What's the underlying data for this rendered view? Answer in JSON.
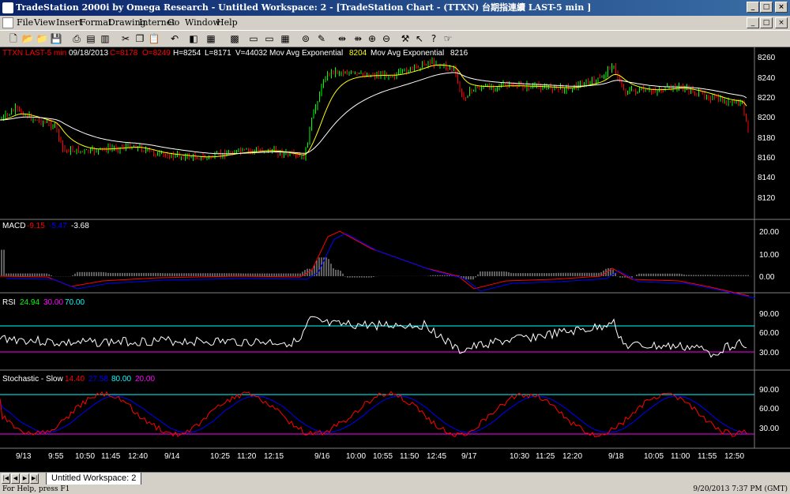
{
  "window": {
    "title": "TradeStation 2000i by Omega Research - Untitled Workspace: 2 - [TradeStation Chart - (TTXN) 台期指連續 LAST-5 min ]",
    "controls": [
      "_",
      "□",
      "×"
    ]
  },
  "menu": {
    "items": [
      "File",
      "View",
      "Insert",
      "Format",
      "Drawing",
      "Internet",
      "Go",
      "Window",
      "Help"
    ],
    "mdi_controls": [
      "_",
      "□",
      "×"
    ]
  },
  "toolbar": {
    "buttons": [
      "new-icon",
      "open-icon",
      "open-folder-icon",
      "save-icon",
      "print-icon",
      "print-preview-icon",
      "page-setup-icon",
      "cut-icon",
      "copy-icon",
      "paste-icon",
      "undo-icon",
      "format-icon",
      "bar-chart-icon",
      "grid-icon",
      "window-icon",
      "window2-icon",
      "tile-icon",
      "radar-icon",
      "zoom-in-icon",
      "zoom-out-icon",
      "tools-icon",
      "pointer-icon",
      "help-icon",
      "expert-icon"
    ]
  },
  "chart": {
    "header": {
      "symbol": "TTXN LAST-5 min",
      "date": "09/18/2013",
      "close": "C=8178",
      "open": "O=8249",
      "high": "H=8254",
      "low": "L=8171",
      "volume": "V=44032",
      "ma1_label": "Mov Avg Exponential",
      "ma1_value": "8204",
      "ma2_label": "Mov Avg Exponential",
      "ma2_value": "8216"
    },
    "price_axis": [
      "8260",
      "8240",
      "8220",
      "8200",
      "8180",
      "8160",
      "8140",
      "8120"
    ],
    "macd": {
      "label": "MACD",
      "v1": "-9.15",
      "v2": "-5.47",
      "v3": "-3.68",
      "axis": [
        "20.00",
        "10.00",
        "0.00"
      ]
    },
    "rsi": {
      "label": "RSI",
      "v1": "24.94",
      "v2": "30.00",
      "v3": "70.00",
      "axis": [
        "90.00",
        "60.00",
        "30.00"
      ]
    },
    "stochastic": {
      "label": "Stochastic - Slow",
      "v1": "14.40",
      "v2": "27.58",
      "v3": "80.00",
      "v4": "20.00",
      "axis": [
        "90.00",
        "60.00",
        "30.00"
      ]
    },
    "time_axis": [
      "9/13",
      "9:55",
      "10:50",
      "11:45",
      "12:40",
      "9/14",
      "10:25",
      "11:20",
      "12:15",
      "9/16",
      "10:00",
      "10:55",
      "11:50",
      "12:45",
      "9/17",
      "10:30",
      "11:25",
      "12:20",
      "9/18",
      "10:05",
      "11:00",
      "11:55",
      "12:50"
    ],
    "colors": {
      "yellow": "#ffff00",
      "white": "#ffffff",
      "red": "#ff0000",
      "blue": "#0000ff",
      "green": "#00ff00",
      "magenta": "#ff00ff",
      "cyan": "#00ffff"
    }
  },
  "tabbar": {
    "tab_label": "Untitled Workspace: 2"
  },
  "status": {
    "left": "For Help, press F1",
    "right": "9/20/2013  7:37 PM (GMT)"
  }
}
